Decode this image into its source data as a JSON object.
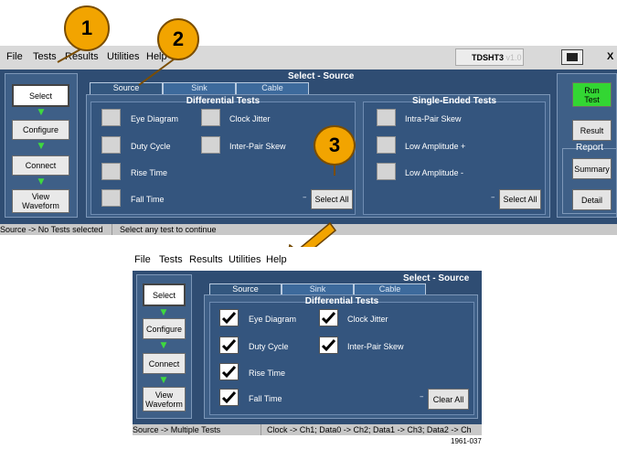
{
  "top": {
    "menu": [
      "File",
      "Tests",
      "Results",
      "Utilities",
      "Help"
    ],
    "app_name": "TDSHT3",
    "app_version": "v1.0",
    "header_title": "Select - Source",
    "nav": [
      "Select",
      "Configure",
      "Connect",
      "View\nWaveform"
    ],
    "tabs": [
      "Source",
      "Sink",
      "Cable"
    ],
    "diff_title": "Differential Tests",
    "diff_left": [
      "Eye Diagram",
      "Duty Cycle",
      "Rise Time",
      "Fall Time"
    ],
    "diff_right": [
      "Clock Jitter",
      "Inter-Pair Skew"
    ],
    "se_title": "Single-Ended Tests",
    "se_tests": [
      "Intra-Pair Skew",
      "Low Amplitude +",
      "Low Amplitude -"
    ],
    "select_all": "Select All",
    "run_test": "Run\nTest",
    "result": "Result",
    "report": "Report",
    "summary": "Summary",
    "detail": "Detail",
    "status_left": "Source -> No Tests selected",
    "status_right": "Select any test to continue",
    "close": "X"
  },
  "bottom": {
    "menu": [
      "File",
      "Tests",
      "Results",
      "Utilities",
      "Help"
    ],
    "header_title": "Select - Source",
    "nav": [
      "Select",
      "Configure",
      "Connect",
      "View\nWaveform"
    ],
    "tabs": [
      "Source",
      "Sink",
      "Cable"
    ],
    "diff_title": "Differential Tests",
    "diff_left": [
      "Eye Diagram",
      "Duty Cycle",
      "Rise Time",
      "Fall Time"
    ],
    "diff_right": [
      "Clock Jitter",
      "Inter-Pair Skew"
    ],
    "clear_all": "Clear All",
    "status_left": "Source -> Multiple Tests",
    "status_right": "Clock -> Ch1; Data0 -> Ch2; Data1 -> Ch3; Data2 -> Ch"
  },
  "callouts": [
    "1",
    "2",
    "3"
  ],
  "figure_id": "1961-037",
  "colors": {
    "callout": "#f2a400",
    "run_test": "#33d633",
    "arrow": "#f2a400"
  }
}
